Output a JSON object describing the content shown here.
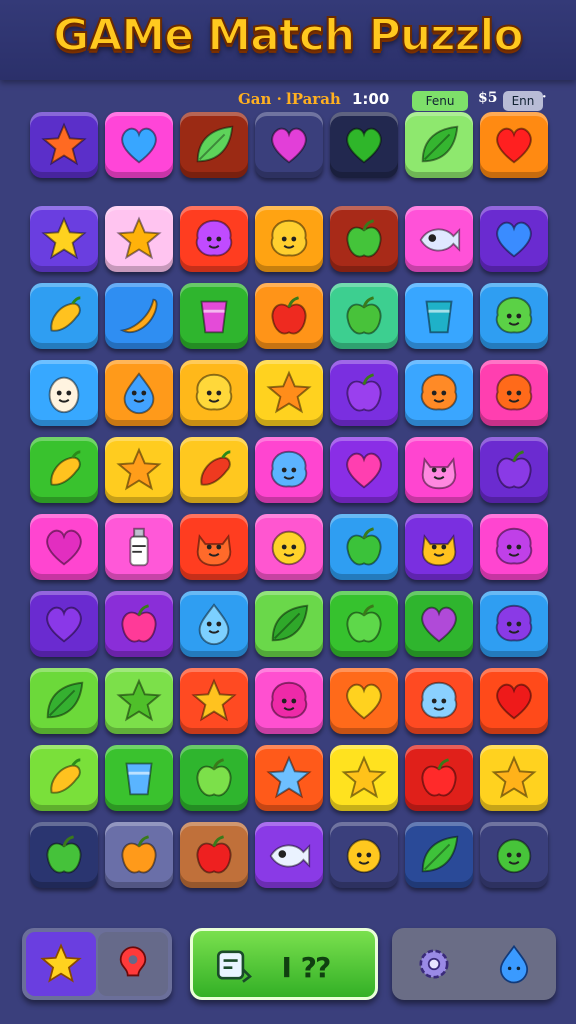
{
  "header": {
    "title": "GAMe Match Puzzlo"
  },
  "status": {
    "game_label": "Gan ·",
    "player_label": "lParah",
    "timer": "1:00",
    "green_pill": "Fenu",
    "score_prefix": "$5",
    "gray_pill": "Enn",
    "dot": "·"
  },
  "tray": [
    {
      "icon": "star-icon",
      "color": "#5b2fc9",
      "fg": "#ff6a22"
    },
    {
      "icon": "heart-icon",
      "color": "#ff45d8",
      "fg": "#38a6ff"
    },
    {
      "icon": "leaf-icon",
      "color": "#9b2a14",
      "fg": "#5ed35a"
    },
    {
      "icon": "heart-icon",
      "color": "#3a3f7c",
      "fg": "#e23fd8"
    },
    {
      "icon": "heart-icon",
      "color": "#22284f",
      "fg": "#2fb62a"
    },
    {
      "icon": "leaf-icon",
      "color": "#8ee86e",
      "fg": "#35b530"
    },
    {
      "icon": "heart-icon",
      "color": "#ff8a12",
      "fg": "#ff2020"
    }
  ],
  "board": [
    [
      {
        "icon": "star-icon",
        "color": "#6a3ee0",
        "fg": "#ffd21f"
      },
      {
        "icon": "star-icon",
        "color": "#ffc4f0",
        "fg": "#ffb20a"
      },
      {
        "icon": "blob-face-icon",
        "color": "#ff3d20",
        "fg": "#c04bff"
      },
      {
        "icon": "blob-face-icon",
        "color": "#ffa312",
        "fg": "#ffcf2f"
      },
      {
        "icon": "apple-icon",
        "color": "#a82a18",
        "fg": "#44c43a"
      },
      {
        "icon": "fish-icon",
        "color": "#ff52d8",
        "fg": "#e0e8ff"
      },
      {
        "icon": "heart-icon",
        "color": "#6a2bd0",
        "fg": "#3a8cff"
      }
    ],
    [
      {
        "icon": "pepper-icon",
        "color": "#2f9ef2",
        "fg": "#ffc21f"
      },
      {
        "icon": "banana-icon",
        "color": "#2f8ef2",
        "fg": "#ffaa1a"
      },
      {
        "icon": "cup-icon",
        "color": "#2fb52e",
        "fg": "#e44bd8"
      },
      {
        "icon": "apple-icon",
        "color": "#ff9418",
        "fg": "#ee2a20"
      },
      {
        "icon": "apple-icon",
        "color": "#3dcf90",
        "fg": "#48c23a"
      },
      {
        "icon": "cup-icon",
        "color": "#38a6ff",
        "fg": "#1fb1c8"
      },
      {
        "icon": "blob-face-icon",
        "color": "#2f9ef2",
        "fg": "#5bd146"
      }
    ],
    [
      {
        "icon": "egg-face-icon",
        "color": "#37a8ff",
        "fg": "#fff4e0"
      },
      {
        "icon": "drop-face-icon",
        "color": "#ff9a1a",
        "fg": "#42a2ff"
      },
      {
        "icon": "blob-face-icon",
        "color": "#ffb81a",
        "fg": "#ffd83a"
      },
      {
        "icon": "star-icon",
        "color": "#ffd21f",
        "fg": "#ff8d1a"
      },
      {
        "icon": "apple-icon",
        "color": "#7a2fe0",
        "fg": "#9a40ee"
      },
      {
        "icon": "blob-face-icon",
        "color": "#3aa6ff",
        "fg": "#ff8a26"
      },
      {
        "icon": "blob-face-icon",
        "color": "#ff3fb0",
        "fg": "#ff6a1a"
      }
    ],
    [
      {
        "icon": "pepper-icon",
        "color": "#39c22e",
        "fg": "#ffc21f"
      },
      {
        "icon": "star-icon",
        "color": "#ffcc1f",
        "fg": "#ff9d1a"
      },
      {
        "icon": "pepper-icon",
        "color": "#ffc81f",
        "fg": "#ee3a20"
      },
      {
        "icon": "blob-face-icon",
        "color": "#ff45d0",
        "fg": "#5cb4ff"
      },
      {
        "icon": "heart-icon",
        "color": "#8a2ee6",
        "fg": "#ff3fb0"
      },
      {
        "icon": "cat-face-icon",
        "color": "#ff45d0",
        "fg": "#ff88e0"
      },
      {
        "icon": "apple-icon",
        "color": "#6b2bd0",
        "fg": "#8a3ae6"
      }
    ],
    [
      {
        "icon": "heart-icon",
        "color": "#ff45d0",
        "fg": "#e22ec0"
      },
      {
        "icon": "bottle-icon",
        "color": "#ff58d8",
        "fg": "#ffffff"
      },
      {
        "icon": "cat-face-icon",
        "color": "#ff3d20",
        "fg": "#ff6a2a"
      },
      {
        "icon": "smile-face-icon",
        "color": "#ff56d0",
        "fg": "#ffd22a"
      },
      {
        "icon": "apple-icon",
        "color": "#2f9ef2",
        "fg": "#3bc23a"
      },
      {
        "icon": "cat-face-icon",
        "color": "#7a2fe0",
        "fg": "#ffc21f"
      },
      {
        "icon": "blob-face-icon",
        "color": "#ff45d0",
        "fg": "#c040e8"
      }
    ],
    [
      {
        "icon": "heart-icon",
        "color": "#6a2bd0",
        "fg": "#8a38e8"
      },
      {
        "icon": "apple-icon",
        "color": "#8a2ed8",
        "fg": "#ff3a98"
      },
      {
        "icon": "drop-face-icon",
        "color": "#2f9ef2",
        "fg": "#7cd0ff"
      },
      {
        "icon": "leaf-icon",
        "color": "#6ad84a",
        "fg": "#2fa82a"
      },
      {
        "icon": "apple-icon",
        "color": "#36c22e",
        "fg": "#5ed84a"
      },
      {
        "icon": "heart-icon",
        "color": "#2fb52e",
        "fg": "#b04ad8"
      },
      {
        "icon": "blob-face-icon",
        "color": "#2f9ef2",
        "fg": "#8a3ae6"
      }
    ],
    [
      {
        "icon": "leaf-icon",
        "color": "#6cd93a",
        "fg": "#35b030"
      },
      {
        "icon": "star-icon",
        "color": "#7ce04a",
        "fg": "#4fbf2a"
      },
      {
        "icon": "star-icon",
        "color": "#ff4a22",
        "fg": "#ffc21f"
      },
      {
        "icon": "blob-face-icon",
        "color": "#ff50d0",
        "fg": "#ee2aa8"
      },
      {
        "icon": "heart-icon",
        "color": "#ff6a1a",
        "fg": "#ffd21f"
      },
      {
        "icon": "blob-face-icon",
        "color": "#ff4a22",
        "fg": "#8ad0ff"
      },
      {
        "icon": "heart-icon",
        "color": "#ff4a1a",
        "fg": "#ee1a1a"
      }
    ],
    [
      {
        "icon": "pepper-icon",
        "color": "#7ae03a",
        "fg": "#ffc21f"
      },
      {
        "icon": "cup-icon",
        "color": "#3ac22e",
        "fg": "#5ab4ff"
      },
      {
        "icon": "apple-icon",
        "color": "#2fb52e",
        "fg": "#7ce04a"
      },
      {
        "icon": "star-icon",
        "color": "#ff5a1a",
        "fg": "#6ec0ff"
      },
      {
        "icon": "star-icon",
        "color": "#ffe21f",
        "fg": "#ffc21a"
      },
      {
        "icon": "apple-icon",
        "color": "#e0201a",
        "fg": "#ff2a2a"
      },
      {
        "icon": "star-icon",
        "color": "#ffd21f",
        "fg": "#ffb21a"
      }
    ],
    [
      {
        "icon": "apple-icon",
        "color": "#2a3570",
        "fg": "#45c23a"
      },
      {
        "icon": "apple-icon",
        "color": "#6a6fa8",
        "fg": "#ff9a1a"
      },
      {
        "icon": "apple-icon",
        "color": "#c0703a",
        "fg": "#ee2020"
      },
      {
        "icon": "fish-icon",
        "color": "#8a3ae6",
        "fg": "#eaf2ff"
      },
      {
        "icon": "smile-face-icon",
        "color": "#3a3f7c",
        "fg": "#ffc81f"
      },
      {
        "icon": "leaf-icon",
        "color": "#2a4a98",
        "fg": "#3ec23a"
      },
      {
        "icon": "smile-face-icon",
        "color": "#3a3f7c",
        "fg": "#47c43a"
      }
    ]
  ],
  "bottom_bar": {
    "left": {
      "icon_a": "star-icon",
      "icon_b": "hint-icon",
      "color_a": "#6a3ee0",
      "color_b": "#6c6f8e",
      "fg_a": "#ffd21f",
      "fg_b": "#ff3a3a"
    },
    "middle": {
      "icon": "shuffle-icon",
      "label": "I ⁇"
    },
    "right": {
      "icon_a": "gear-icon",
      "icon_b": "drop-face-icon"
    }
  }
}
